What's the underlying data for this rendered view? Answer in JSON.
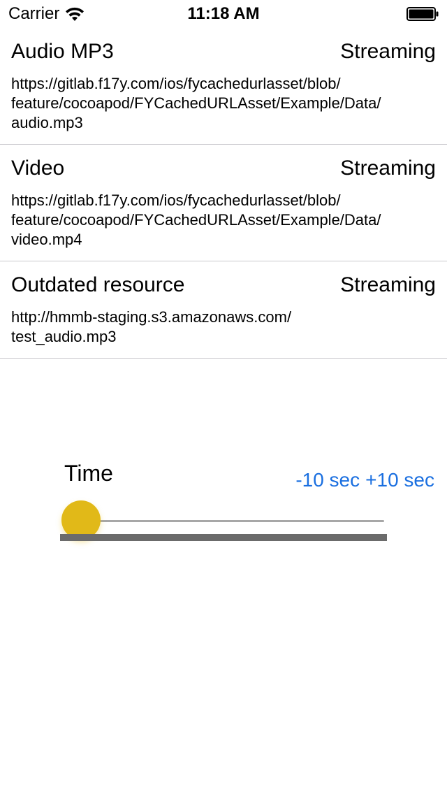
{
  "status_bar": {
    "carrier": "Carrier",
    "time": "11:18 AM",
    "wifi_icon": "wifi-icon",
    "battery_icon": "battery-icon"
  },
  "list": {
    "items": [
      {
        "title": "Audio MP3",
        "status": "Streaming",
        "url_lines": [
          "https://gitlab.f17y.com/ios/fycachedurlasset/blob/",
          "feature/cocoapod/FYCachedURLAsset/Example/Data/",
          "audio.mp3"
        ]
      },
      {
        "title": "Video",
        "status": "Streaming",
        "url_lines": [
          "https://gitlab.f17y.com/ios/fycachedurlasset/blob/",
          "feature/cocoapod/FYCachedURLAsset/Example/Data/",
          "video.mp4"
        ]
      },
      {
        "title": "Outdated resource",
        "status": "Streaming",
        "url_lines": [
          "http://hmmb-staging.s3.amazonaws.com/",
          "test_audio.mp3"
        ]
      }
    ]
  },
  "player": {
    "time_label": "Time",
    "rewind_label": "-10 sec",
    "forward_label": "+10 sec",
    "position": 0.0,
    "buffered": 1.0,
    "colors": {
      "accent": "#1a6fe0",
      "thumb": "#e1b918",
      "track": "#a7a7a7",
      "progress": "#6b6b6b"
    }
  }
}
